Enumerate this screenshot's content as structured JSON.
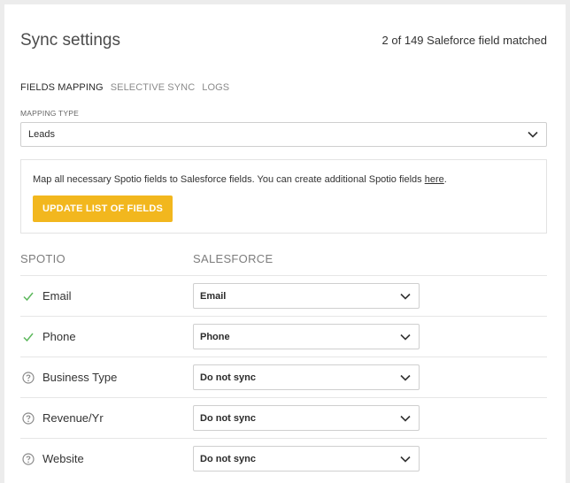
{
  "header": {
    "title": "Sync settings",
    "matched_text": "2 of 149 Saleforce field matched"
  },
  "tabs": [
    {
      "label": "FIELDS MAPPING",
      "active": true
    },
    {
      "label": "SELECTIVE SYNC",
      "active": false
    },
    {
      "label": "LOGS",
      "active": false
    }
  ],
  "mapping_type": {
    "label": "MAPPING TYPE",
    "value": "Leads"
  },
  "info": {
    "text": "Map all necessary Spotio fields to Salesforce fields. You can create additional Spotio fields ",
    "link_text": "here",
    "text_end": ".",
    "button_label": "UPDATE LIST OF FIELDS"
  },
  "columns": {
    "spotio": "SPOTIO",
    "salesforce": "SALESFORCE"
  },
  "rows": [
    {
      "spotio_field": "Email",
      "salesforce_field": "Email",
      "status": "matched"
    },
    {
      "spotio_field": "Phone",
      "salesforce_field": "Phone",
      "status": "matched"
    },
    {
      "spotio_field": "Business Type",
      "salesforce_field": "Do not sync",
      "status": "unmatched"
    },
    {
      "spotio_field": "Revenue/Yr",
      "salesforce_field": "Do not sync",
      "status": "unmatched"
    },
    {
      "spotio_field": "Website",
      "salesforce_field": "Do not sync",
      "status": "unmatched"
    }
  ],
  "colors": {
    "accent": "#f2b71e",
    "check": "#5cb85c",
    "help_icon": "#8a8a8a"
  }
}
